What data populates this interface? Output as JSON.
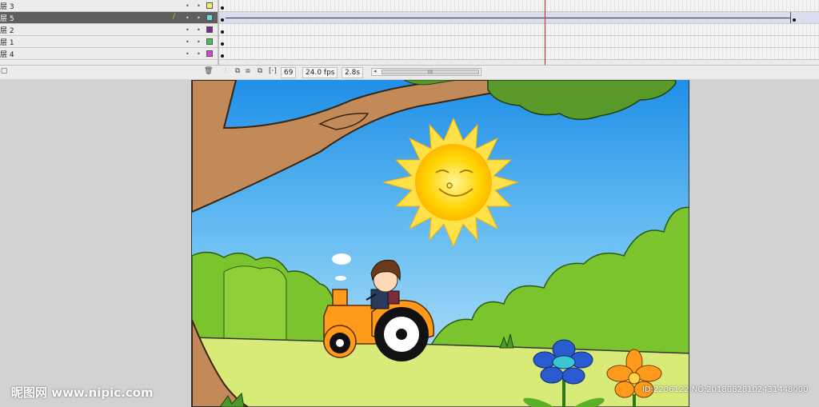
{
  "layers": [
    {
      "name": "层 3",
      "color": "#f3f066",
      "selected": false
    },
    {
      "name": "层 5",
      "color": "#6fdcdc",
      "selected": true
    },
    {
      "name": "层 2",
      "color": "#7a2a8a",
      "selected": false
    },
    {
      "name": "层 1",
      "color": "#47c24a",
      "selected": false
    },
    {
      "name": "层 4",
      "color": "#d24ad0",
      "selected": false
    }
  ],
  "timeline": {
    "frame": "69",
    "fps": "24.0 fps",
    "time": "2.8s",
    "scroll_grip": "III"
  },
  "watermark": {
    "left": "昵图网 www.nipic.com",
    "right": "ID:2206122 NO:20180828102431448000"
  },
  "icons": [
    "new-layer-icon",
    "trash-icon",
    "onion-skin-icon",
    "onion-outline-icon",
    "edit-multiple-frames-icon",
    "modify-markers-icon",
    "pencil-icon"
  ]
}
